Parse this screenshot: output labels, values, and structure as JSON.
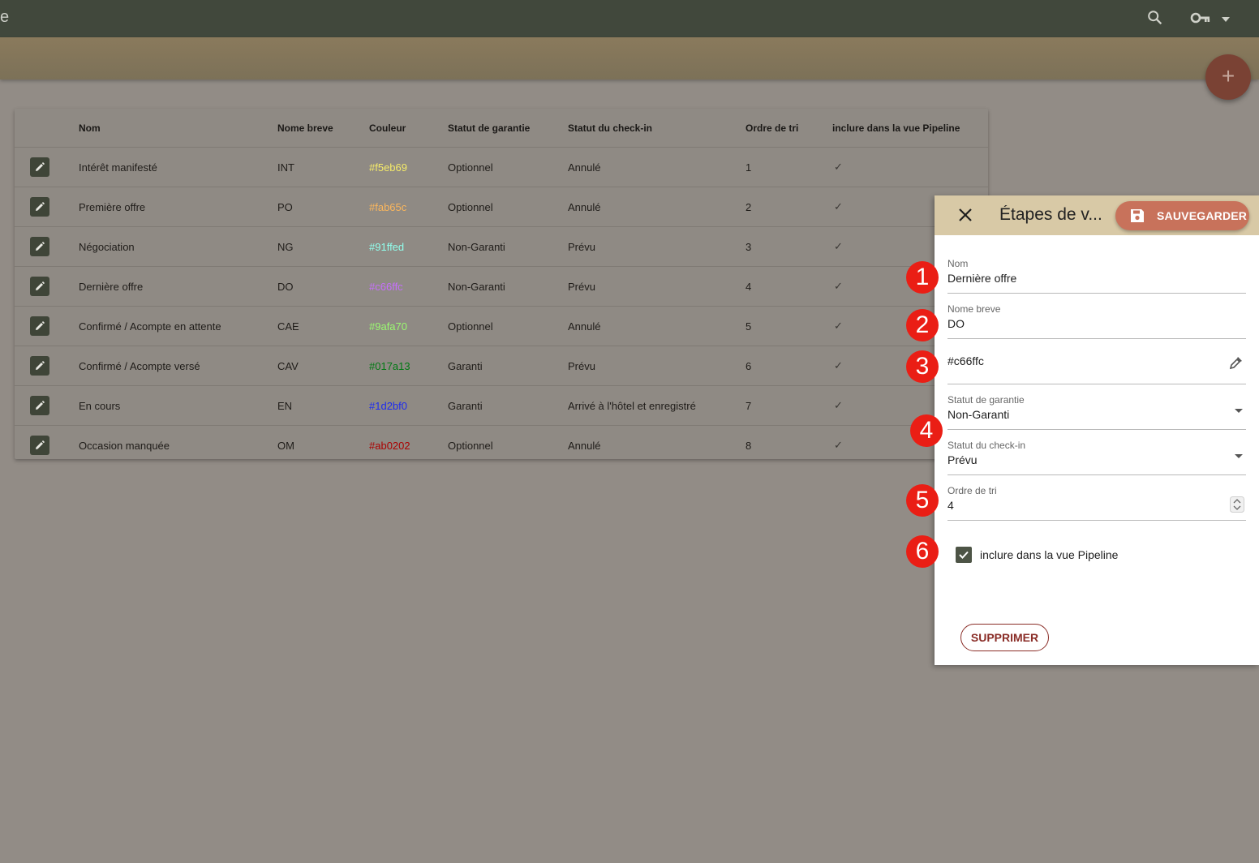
{
  "app": {
    "title_fragment": "e"
  },
  "topbar": {
    "search_icon": "search-icon",
    "key_icon": "key-icon",
    "menu_icon": "arrow-drop-down-icon"
  },
  "fab": {
    "label": "+"
  },
  "table": {
    "headers": [
      "Nom",
      "Nome breve",
      "Couleur",
      "Statut de garantie",
      "Statut du check-in",
      "Ordre de tri",
      "inclure dans la vue Pipeline"
    ],
    "rows": [
      {
        "nom": "Intérêt manifesté",
        "short": "INT",
        "color": "#f5eb69",
        "garantie": "Optionnel",
        "checkin": "Annulé",
        "ordre": "1",
        "pipeline": "✓"
      },
      {
        "nom": "Première offre",
        "short": "PO",
        "color": "#fab65c",
        "garantie": "Optionnel",
        "checkin": "Annulé",
        "ordre": "2",
        "pipeline": "✓"
      },
      {
        "nom": "Négociation",
        "short": "NG",
        "color": "#91ffed",
        "garantie": "Non-Garanti",
        "checkin": "Prévu",
        "ordre": "3",
        "pipeline": "✓"
      },
      {
        "nom": "Dernière offre",
        "short": "DO",
        "color": "#c66ffc",
        "garantie": "Non-Garanti",
        "checkin": "Prévu",
        "ordre": "4",
        "pipeline": "✓"
      },
      {
        "nom": "Confirmé / Acompte en attente",
        "short": "CAE",
        "color": "#9afa70",
        "garantie": "Optionnel",
        "checkin": "Annulé",
        "ordre": "5",
        "pipeline": "✓"
      },
      {
        "nom": "Confirmé / Acompte versé",
        "short": "CAV",
        "color": "#017a13",
        "garantie": "Garanti",
        "checkin": "Prévu",
        "ordre": "6",
        "pipeline": "✓"
      },
      {
        "nom": "En cours",
        "short": "EN",
        "color": "#1d2bf0",
        "garantie": "Garanti",
        "checkin": "Arrivé à l'hôtel et enregistré",
        "ordre": "7",
        "pipeline": "✓"
      },
      {
        "nom": "Occasion manquée",
        "short": "OM",
        "color": "#ab0202",
        "garantie": "Optionnel",
        "checkin": "Annulé",
        "ordre": "8",
        "pipeline": "✓"
      }
    ]
  },
  "panel": {
    "title": "Étapes de v...",
    "save_label": "SAUVEGARDER",
    "fields": {
      "nom": {
        "label": "Nom",
        "value": "Dernière offre"
      },
      "short": {
        "label": "Nome breve",
        "value": "DO"
      },
      "color": {
        "value": "#c66ffc"
      },
      "garantie": {
        "label": "Statut de garantie",
        "value": "Non-Garanti"
      },
      "checkin": {
        "label": "Statut du check-in",
        "value": "Prévu"
      },
      "ordre": {
        "label": "Ordre de tri",
        "value": "4"
      }
    },
    "pipeline_checkbox": {
      "label": "inclure dans la vue Pipeline",
      "checked": true
    },
    "delete_label": "SUPPRIMER"
  },
  "badges": [
    "1",
    "2",
    "3",
    "4",
    "5",
    "6"
  ],
  "colors": {
    "topbar": "#41483c",
    "accent": "#c8725b",
    "danger": "#8a2d27",
    "badge": "#ea1e15"
  }
}
